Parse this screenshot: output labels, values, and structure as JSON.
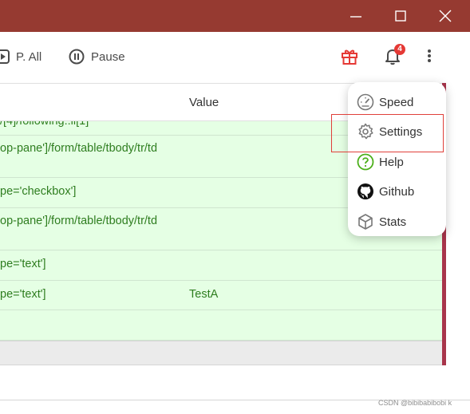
{
  "window": {
    "controls": [
      "minimize",
      "maximize",
      "close"
    ],
    "title_color": "#963a31"
  },
  "toolbar": {
    "play_all_label": "P. All",
    "pause_label": "Pause",
    "notification_count": "4"
  },
  "table": {
    "header_value": "Value",
    "rows": [
      {
        "locator": "/[4]/following::li[1]",
        "value": ""
      },
      {
        "locator": "op-pane']/form/table/tbody/tr/td",
        "value": ""
      },
      {
        "locator": "pe='checkbox']",
        "value": ""
      },
      {
        "locator": "op-pane']/form/table/tbody/tr/td",
        "value": ""
      },
      {
        "locator": "pe='text']",
        "value": ""
      },
      {
        "locator": "pe='text']",
        "value": "TestA"
      },
      {
        "locator": "",
        "value": ""
      }
    ]
  },
  "menu": {
    "items": [
      "Speed",
      "Settings",
      "Help",
      "Github",
      "Stats"
    ],
    "highlighted": "Settings"
  },
  "watermark": "CSDN @bibibabibobi  k",
  "colors": {
    "row_bg": "#e5ffe4",
    "row_text": "#2e7d1f",
    "accent": "#a8354b",
    "badge": "#e53935"
  }
}
